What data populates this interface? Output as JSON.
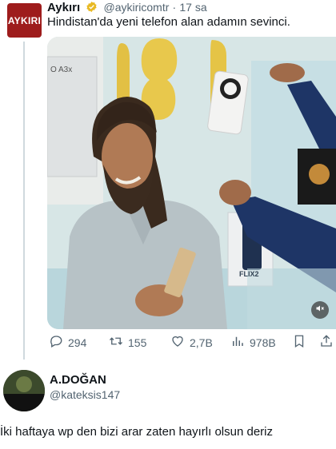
{
  "tweet": {
    "avatar_text": "AYKIRI",
    "name": "Aykırı",
    "handle": "@aykiricomtr",
    "separator": "·",
    "time": "17 sa",
    "text": "Hindistan'da yeni telefon alan adamın sevinci.",
    "media": {
      "box_text_1": "O A3x",
      "box_text_2": "FLIX2"
    },
    "stats": {
      "replies": "294",
      "retweets": "155",
      "likes": "2,7B",
      "views": "978B"
    },
    "icons": [
      "reply-icon",
      "retweet-icon",
      "like-icon",
      "views-icon",
      "bookmark-icon",
      "share-icon",
      "mute-icon",
      "verified-icon"
    ]
  },
  "reply": {
    "name": "A.DOĞAN",
    "handle": "@kateksis147",
    "text": "İki haftaya wp den bizi arar zaten hayırlı olsun deriz"
  },
  "colors": {
    "text": "#0f1419",
    "muted": "#536471",
    "verified": "#e8b923",
    "brand": "#9e1c1c"
  }
}
